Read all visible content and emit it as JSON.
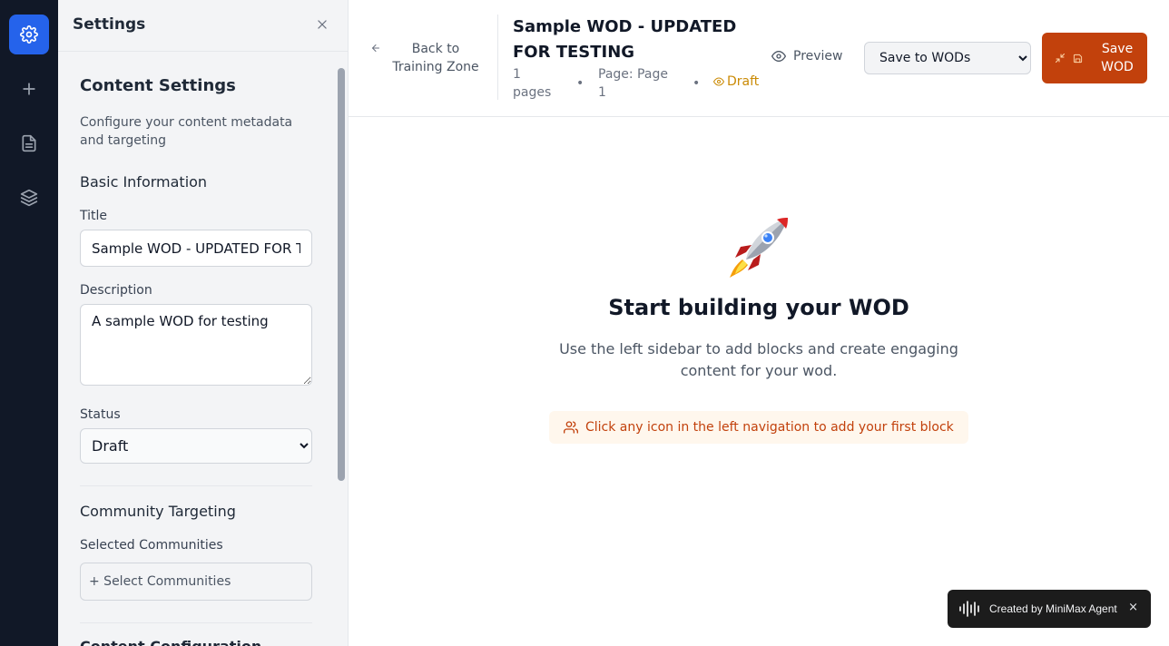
{
  "rail": {
    "items": [
      {
        "icon": "gear-icon",
        "active": true
      },
      {
        "icon": "plus-icon",
        "active": false
      },
      {
        "icon": "document-icon",
        "active": false
      },
      {
        "icon": "layers-icon",
        "active": false
      }
    ],
    "accent": "#2563eb"
  },
  "panel": {
    "title": "Settings",
    "heading": "Content Settings",
    "description": "Configure your content metadata and targeting",
    "basic_info": "Basic Information",
    "title_label": "Title",
    "title_value": "Sample WOD - UPDATED FOR TESTING",
    "description_label": "Description",
    "description_value": "A sample WOD for testing",
    "status_label": "Status",
    "status_value": "Draft",
    "community_targeting": "Community Targeting",
    "selected_communities_label": "Selected Communities",
    "select_communities_button": "+ Select Communities",
    "content_configuration": "Content Configuration"
  },
  "header": {
    "back_label": "Back to Training Zone",
    "doc_title": "Sample WOD - UPDATED FOR TESTING",
    "pages": "1 pages",
    "page": "Page: Page 1",
    "bullet": "•",
    "status": "Draft",
    "preview_label": "Preview",
    "save_target": "Save to WODs",
    "save_label": "Save WOD",
    "brand_color": "#c2410c",
    "draft_color": "#ca8a04"
  },
  "main": {
    "emoji": "🚀",
    "empty_title": "Start building your WOD",
    "empty_description": "Use the left sidebar to add blocks and create engaging content for your wod.",
    "hint": "Click any icon in the left navigation to add your first block"
  },
  "toast": {
    "label": "Created by MiniMax Agent",
    "close": "×"
  }
}
